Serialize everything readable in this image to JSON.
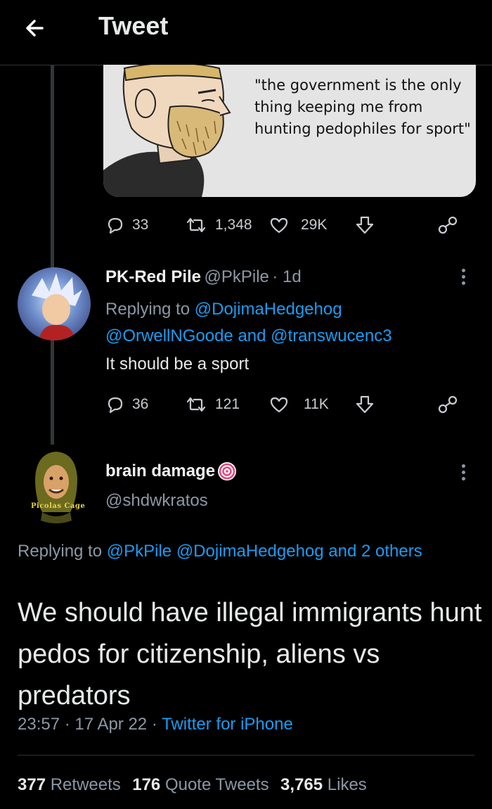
{
  "header": {
    "title": "Tweet"
  },
  "parent_tweet": {
    "meme_text": "\"the government is the only thing keeping me from hunting pedophiles for sport\"",
    "replies": "33",
    "retweets": "1,348",
    "likes": "29K"
  },
  "reply_tweet": {
    "name": "PK-Red Pile",
    "handle": "@PkPile",
    "time": "· 1d",
    "replying_to_prefix": "Replying to",
    "mention1": "@DojimaHedgehog",
    "mention2": "@OrwellNGoode",
    "and_text": "and",
    "mention3": "@transwucenc3",
    "text": "It should be a sport",
    "replies": "36",
    "retweets": "121",
    "likes": "11K"
  },
  "main_tweet": {
    "name": "brain damage",
    "handle": "@shdwkratos",
    "avatar_caption": "Picolas Cage",
    "replying_to_prefix": "Replying to",
    "mention1": "@PkPile",
    "mention2": "@DojimaHedgehog",
    "and_others": "and 2 others",
    "text": "We should have illegal immigrants hunt pedos for citizenship, aliens vs predators",
    "time": "23:57",
    "date": "17 Apr 22",
    "source": "Twitter for iPhone",
    "retweets_count": "377",
    "retweets_label": "Retweets",
    "quotes_count": "176",
    "quotes_label": "Quote Tweets",
    "likes_count": "3,765",
    "likes_label": "Likes"
  },
  "colors": {
    "background": "#000000",
    "accent": "#1d9bf0",
    "secondary_text": "#8b98a5"
  }
}
